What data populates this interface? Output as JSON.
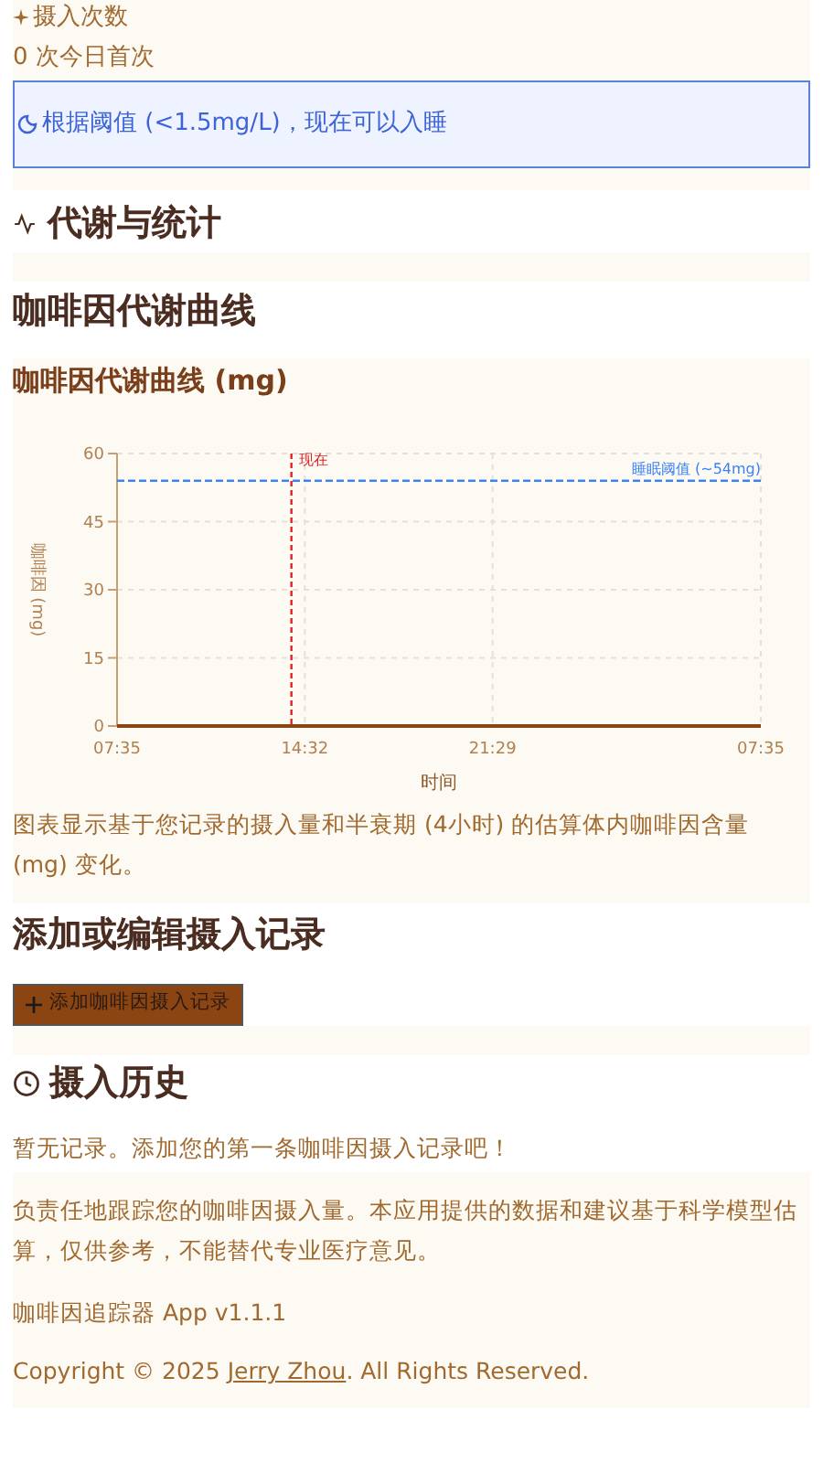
{
  "stats_card": {
    "label": "摄入次数",
    "value": "0 次今日首次",
    "sleep_notice": "根据阈值 (<1.5mg/L)，现在可以入睡"
  },
  "metabolism_section": {
    "title": "代谢与统计"
  },
  "curve_section": {
    "title": "咖啡因代谢曲线",
    "card_title": "咖啡因代谢曲线 (mg)",
    "chart_data": {
      "type": "line",
      "xlabel": "时间",
      "ylabel": "咖啡因 (mg)",
      "categories": [
        "07:35",
        null,
        null,
        null,
        null,
        null,
        null,
        "14:32",
        null,
        null,
        null,
        null,
        null,
        null,
        "21:29",
        null,
        null,
        null,
        null,
        null,
        null,
        null,
        null,
        null,
        "07:35"
      ],
      "series": [
        {
          "color": "#8b4513",
          "values": [
            0,
            0,
            0,
            0,
            0,
            0,
            0,
            0,
            0,
            0,
            0,
            0,
            0,
            0,
            0,
            0,
            0,
            0,
            0,
            0,
            0,
            0,
            0,
            0,
            0
          ]
        }
      ],
      "ylim": [
        0,
        60
      ],
      "yticks": [
        0,
        15,
        30,
        45,
        60
      ],
      "grid": true,
      "annotations": [
        {
          "text": "现在"
        }
      ],
      "ref_lines": [
        {
          "axis": "y",
          "value": 54,
          "label": "睡眠阈值 (~54mg)",
          "color": "#3b82f6"
        }
      ]
    },
    "note": "图表显示基于您记录的摄入量和半衰期 (4小时) 的估算体内咖啡因含量 (mg) 变化。"
  },
  "add_section": {
    "title": "添加或编辑摄入记录",
    "add_button": "添加咖啡因摄入记录"
  },
  "history_section": {
    "title": "摄入历史",
    "empty_text": "暂无记录。添加您的第一条咖啡因摄入记录吧！"
  },
  "footer": {
    "disclaimer": "负责任地跟踪您的咖啡因摄入量。本应用提供的数据和建议基于科学模型估算，仅供参考，不能替代专业医疗意见。",
    "version": "咖啡因追踪器 App v1.1.1",
    "copyright_prefix": "Copyright © 2025 ",
    "author_link": "Jerry Zhou",
    "copyright_suffix": ". All Rights Reserved."
  }
}
